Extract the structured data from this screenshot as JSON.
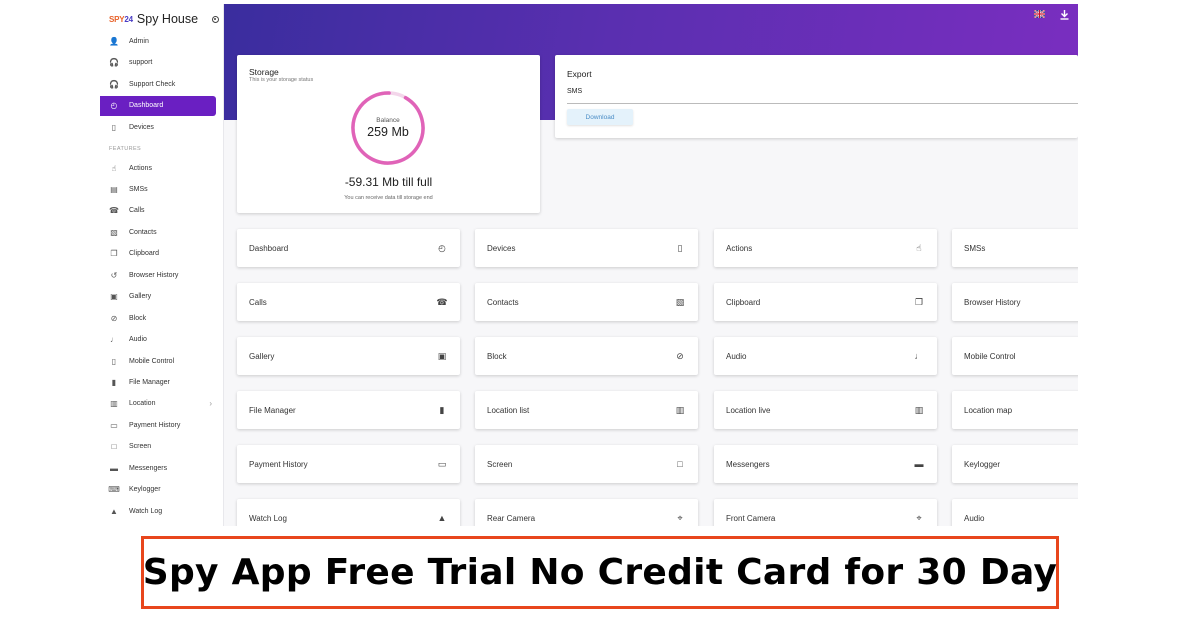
{
  "brand": {
    "logo_prefix": "SPY",
    "logo_suffix": "24",
    "name": "Spy House"
  },
  "sidebar": {
    "section_label": "FEATURES",
    "top_items": [
      {
        "label": "Admin",
        "icon": "person-icon"
      },
      {
        "label": "support",
        "icon": "headset-icon"
      },
      {
        "label": "Support Check",
        "icon": "headset-icon"
      },
      {
        "label": "Dashboard",
        "icon": "dashboard-icon",
        "active": true
      },
      {
        "label": "Devices",
        "icon": "phone-icon"
      }
    ],
    "feature_items": [
      {
        "label": "Actions",
        "icon": "touch-icon"
      },
      {
        "label": "SMSs",
        "icon": "message-icon"
      },
      {
        "label": "Calls",
        "icon": "call-icon"
      },
      {
        "label": "Contacts",
        "icon": "contacts-icon"
      },
      {
        "label": "Clipboard",
        "icon": "clipboard-icon"
      },
      {
        "label": "Browser History",
        "icon": "history-icon"
      },
      {
        "label": "Gallery",
        "icon": "image-icon"
      },
      {
        "label": "Block",
        "icon": "block-icon"
      },
      {
        "label": "Audio",
        "icon": "mic-icon"
      },
      {
        "label": "Mobile Control",
        "icon": "phone-icon"
      },
      {
        "label": "File Manager",
        "icon": "file-icon"
      },
      {
        "label": "Location",
        "icon": "map-icon",
        "expandable": true
      },
      {
        "label": "Payment History",
        "icon": "card-icon"
      },
      {
        "label": "Screen",
        "icon": "monitor-icon"
      },
      {
        "label": "Messengers",
        "icon": "chat-icon"
      },
      {
        "label": "Keylogger",
        "icon": "keyboard-icon"
      },
      {
        "label": "Watch Log",
        "icon": "bell-icon"
      }
    ]
  },
  "header": {
    "icons": [
      "flag-uk-icon",
      "download-icon"
    ]
  },
  "storage": {
    "title": "Storage",
    "subtitle": "This is your storage status",
    "balance_label": "Balance",
    "balance_value": "259 Mb",
    "till_full": "-59.31 Mb till full",
    "note": "You can receive data till storage end",
    "ring_fill_fraction": 0.92,
    "ring_color": "#e063b8"
  },
  "export": {
    "title": "Export",
    "field_value": "SMS",
    "button": "Download"
  },
  "cards": [
    [
      {
        "label": "Dashboard",
        "icon": "dashboard-icon"
      },
      {
        "label": "Devices",
        "icon": "phone-icon"
      },
      {
        "label": "Actions",
        "icon": "touch-icon"
      },
      {
        "label": "SMSs",
        "icon": "message-icon"
      }
    ],
    [
      {
        "label": "Calls",
        "icon": "call-icon"
      },
      {
        "label": "Contacts",
        "icon": "contacts-icon"
      },
      {
        "label": "Clipboard",
        "icon": "clipboard-icon"
      },
      {
        "label": "Browser History",
        "icon": "history-icon"
      }
    ],
    [
      {
        "label": "Gallery",
        "icon": "image-icon"
      },
      {
        "label": "Block",
        "icon": "block-icon"
      },
      {
        "label": "Audio",
        "icon": "mic-icon"
      },
      {
        "label": "Mobile Control",
        "icon": "phone-icon"
      }
    ],
    [
      {
        "label": "File Manager",
        "icon": "file-icon"
      },
      {
        "label": "Location list",
        "icon": "map-icon"
      },
      {
        "label": "Location live",
        "icon": "map-icon"
      },
      {
        "label": "Location map",
        "icon": "map-icon"
      }
    ],
    [
      {
        "label": "Payment History",
        "icon": "card-icon"
      },
      {
        "label": "Screen",
        "icon": "monitor-icon"
      },
      {
        "label": "Messengers",
        "icon": "chat-icon"
      },
      {
        "label": "Keylogger",
        "icon": "keyboard-icon"
      }
    ],
    [
      {
        "label": "Watch Log",
        "icon": "bell-icon"
      },
      {
        "label": "Rear Camera",
        "icon": "camera-icon"
      },
      {
        "label": "Front Camera",
        "icon": "camera-icon"
      },
      {
        "label": "Audio",
        "icon": "mic-icon"
      }
    ]
  ],
  "caption": "Spy App Free Trial No Credit Card for 30 Day",
  "colors": {
    "accent": "#6a1fc2",
    "header_start": "#3a2d9e",
    "header_end": "#7a2ec0",
    "caption_border": "#e8461c"
  }
}
